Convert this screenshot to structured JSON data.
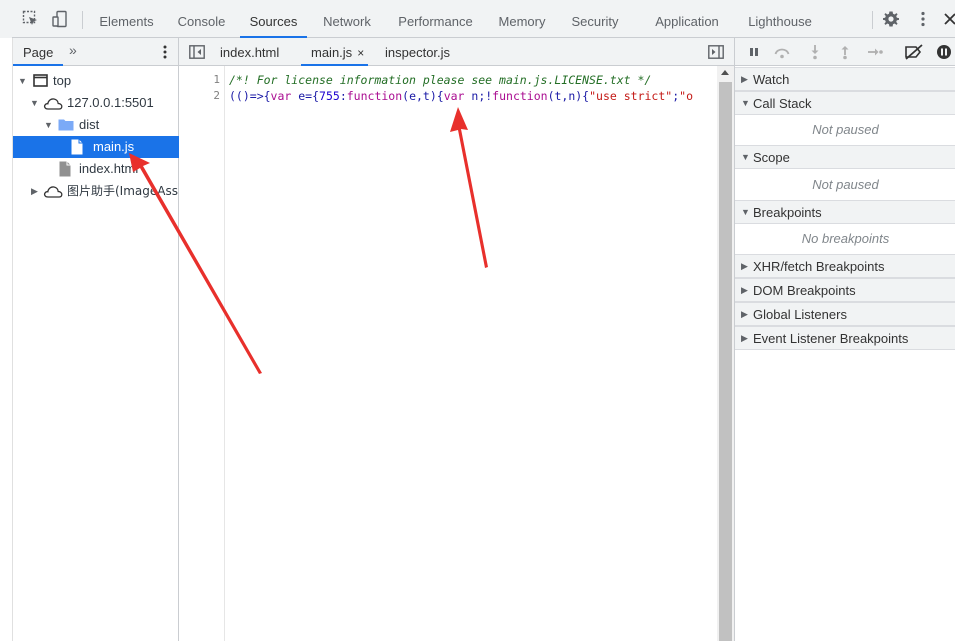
{
  "main_tabs": [
    "Elements",
    "Console",
    "Sources",
    "Network",
    "Performance",
    "Memory",
    "Security",
    "Application",
    "Lighthouse"
  ],
  "active_main_tab": "Sources",
  "navigator": {
    "tab_label": "Page",
    "more_label": "»",
    "tree": [
      {
        "label": "top",
        "icon": "frame-icon",
        "expanded": true
      },
      {
        "label": "127.0.0.1:5501",
        "icon": "cloud-icon",
        "expanded": true
      },
      {
        "label": "dist",
        "icon": "folder-icon",
        "expanded": true
      },
      {
        "label": "main.js",
        "icon": "file-icon",
        "selected": true
      },
      {
        "label": "index.html",
        "icon": "file-icon"
      },
      {
        "label": "图片助手(ImageAssistant)",
        "icon": "cloud-icon",
        "expanded": false
      }
    ]
  },
  "editor": {
    "tabs": [
      {
        "label": "index.html",
        "active": false
      },
      {
        "label": "main.js",
        "active": true,
        "close": "×"
      },
      {
        "label": "inspector.js",
        "active": false
      }
    ],
    "line_numbers": [
      "1",
      "2"
    ],
    "line1_comment": "/*! For license information please see main.js.LICENSE.txt */",
    "line2": {
      "p1": "(()=>{",
      "k1": "var",
      "p2": " e={",
      "n1": "755",
      "p3": ":",
      "k2": "function",
      "p4": "(e,t){",
      "k3": "var",
      "p5": " n;!",
      "k4": "function",
      "p6": "(t,n){",
      "s1": "\"use strict\"",
      "p7": ";",
      "s2": "\"o"
    }
  },
  "debugger": {
    "sections": [
      {
        "title": "Watch",
        "expanded": false
      },
      {
        "title": "Call Stack",
        "expanded": true,
        "body": "Not paused"
      },
      {
        "title": "Scope",
        "expanded": true,
        "body": "Not paused"
      },
      {
        "title": "Breakpoints",
        "expanded": true,
        "body": "No breakpoints"
      },
      {
        "title": "XHR/fetch Breakpoints",
        "expanded": false
      },
      {
        "title": "DOM Breakpoints",
        "expanded": false
      },
      {
        "title": "Global Listeners",
        "expanded": false
      },
      {
        "title": "Event Listener Breakpoints",
        "expanded": false
      }
    ]
  },
  "colors": {
    "accent": "#1a73e8",
    "annotation_arrow": "#e8302c",
    "comment": "#236e25",
    "keyword": "#aa0d91",
    "string": "#c41a16"
  }
}
